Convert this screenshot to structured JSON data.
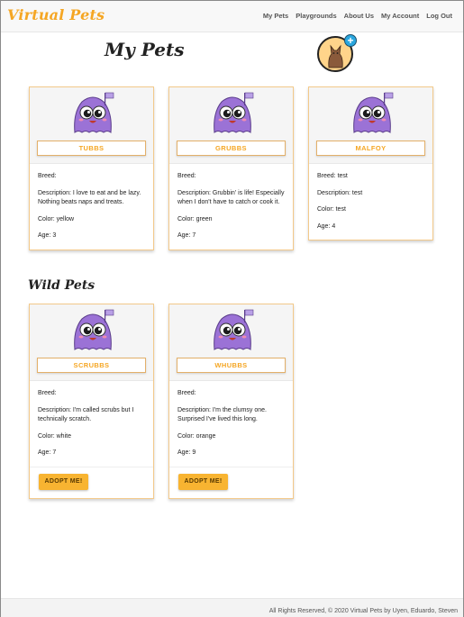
{
  "nav": {
    "brand": "Virtual Pets",
    "links": [
      "My Pets",
      "Playgrounds",
      "About Us",
      "My Account",
      "Log Out"
    ]
  },
  "my_pets": {
    "title": "My Pets",
    "cards": [
      {
        "name": "TUBBS",
        "breed": "Breed:",
        "description": "Description: I love to eat and be lazy. Nothing beats naps and treats.",
        "color": "Color: yellow",
        "age": "Age: 3"
      },
      {
        "name": "GRUBBS",
        "breed": "Breed:",
        "description": "Description: Grubbin' is life! Especially when I don't have to catch or cook it.",
        "color": "Color: green",
        "age": "Age: 7"
      },
      {
        "name": "MALFOY",
        "breed": "Breed: test",
        "description": "Description: test",
        "color": "Color: test",
        "age": "Age: 4"
      }
    ]
  },
  "wild_pets": {
    "title": "Wild Pets",
    "adopt_label": "ADOPT ME!",
    "cards": [
      {
        "name": "SCRUBBS",
        "breed": "Breed:",
        "description": "Description: I'm called scrubs but I technically scratch.",
        "color": "Color: white",
        "age": "Age: 7"
      },
      {
        "name": "WHUBBS",
        "breed": "Breed:",
        "description": "Description: I'm the clumsy one. Surprised I've lived this long.",
        "color": "Color: orange",
        "age": "Age: 9"
      }
    ]
  },
  "add_pet_icon": "cat-add-icon",
  "pet_icon": "purple-ghost-pet-icon",
  "colors": {
    "accent": "#f5a623",
    "pet_purple": "#9b72d6",
    "adopt_button": "#f8b431"
  },
  "footer": {
    "text": "All Rights Reserved, © 2020 Virtual Pets by Uyen, Eduardo, Steven"
  }
}
